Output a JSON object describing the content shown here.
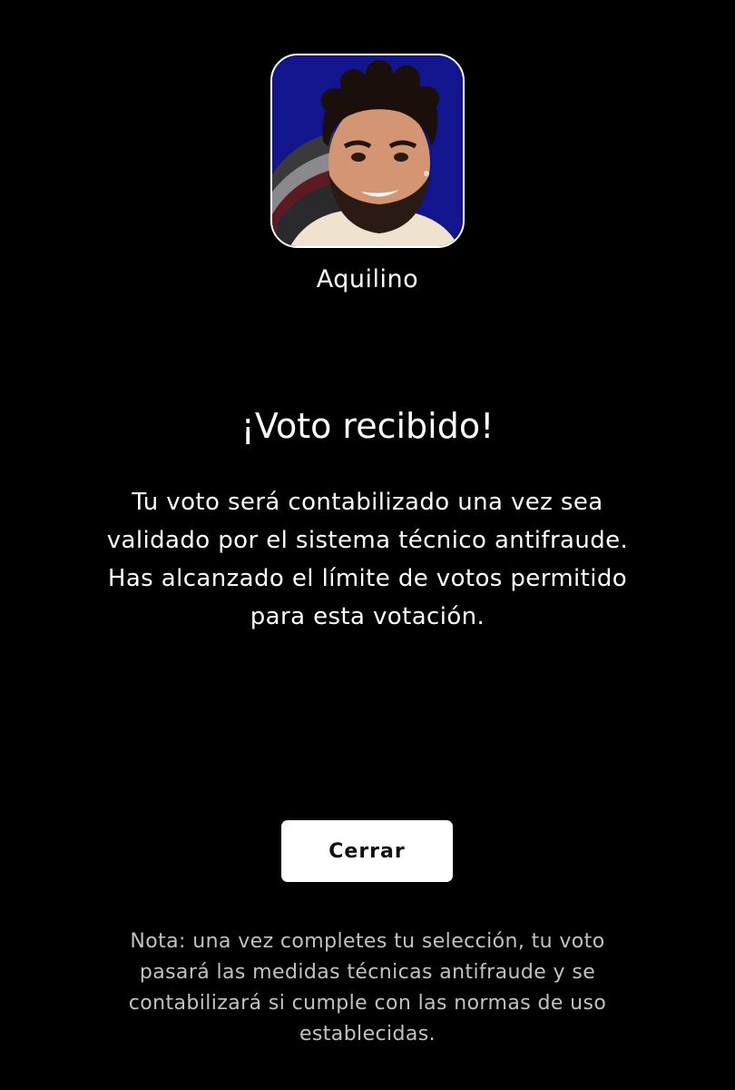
{
  "contestant": {
    "name": "Aquilino",
    "photo_icon": "contestant-portrait"
  },
  "confirmation": {
    "title": "¡Voto recibido!",
    "message_lines": [
      "Tu voto será contabilizado una vez sea",
      "validado por el sistema técnico antifraude.",
      "Has alcanzado el límite de votos permitido",
      "para esta votación."
    ]
  },
  "actions": {
    "close_label": "Cerrar"
  },
  "footer": {
    "note_lines": [
      "Nota: una vez completes tu selección, tu voto",
      "pasará las medidas técnicas antifraude y se",
      "contabilizará si cumple con las normas de uso",
      "establecidas."
    ]
  },
  "colors": {
    "background": "#000000",
    "text": "#ffffff",
    "note_text": "#c2c2c2",
    "button_bg": "#ffffff",
    "button_text": "#111111",
    "photo_bg": "#13158f"
  }
}
